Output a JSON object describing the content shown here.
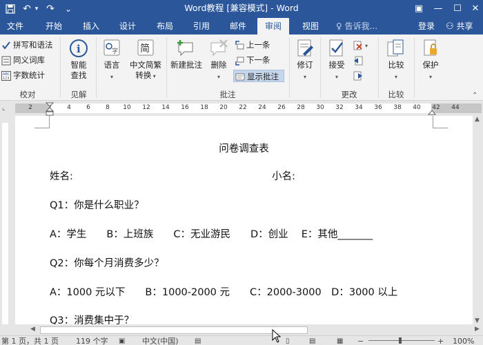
{
  "titlebar": {
    "title": "Word教程 [兼容模式] - Word",
    "undo": "↶",
    "redo": "↷",
    "customize": "⌄",
    "ribbon_options": "▣",
    "minimize": "—",
    "maximize": "☐",
    "close": "✕"
  },
  "tabs": [
    {
      "label": "文件"
    },
    {
      "label": "开始"
    },
    {
      "label": "插入"
    },
    {
      "label": "设计"
    },
    {
      "label": "布局"
    },
    {
      "label": "引用"
    },
    {
      "label": "邮件"
    },
    {
      "label": "审阅"
    },
    {
      "label": "视图"
    }
  ],
  "tellme": "♀ 告诉我...",
  "login": "登录",
  "share": "共享",
  "ribbon": {
    "proofing": {
      "items": [
        "拼写和语法",
        "同义词库",
        "字数统计"
      ],
      "label": "校对"
    },
    "insights": {
      "smart_lookup_line1": "智能",
      "smart_lookup_line2": "查找",
      "label": "见解"
    },
    "language": {
      "language": "语言",
      "convert_line1": "中文简繁",
      "convert_line2": "转换"
    },
    "comments": {
      "new_line1": "新建批注",
      "delete": "删除",
      "previous": "上一条",
      "next": "下一条",
      "show": "显示批注",
      "label": "批注"
    },
    "tracking": {
      "track": "修订"
    },
    "changes": {
      "accept": "接受",
      "label": "更改"
    },
    "compare": {
      "compare": "比较",
      "label": "比较"
    },
    "protect": {
      "protect": "保护"
    }
  },
  "ruler_ticks": [
    "2",
    "2",
    "4",
    "6",
    "8",
    "10",
    "12",
    "14",
    "16",
    "18",
    "20",
    "22",
    "24",
    "26",
    "28",
    "30",
    "32",
    "34",
    "36",
    "38",
    "40",
    "42",
    "44"
  ],
  "document": {
    "title": "问卷调查表",
    "name_label": "姓名:",
    "nickname_label": "小名:",
    "q1": "Q1：你是什么职业？",
    "q1_options": "A：学生　　B：上班族　　C：无业游民　　D：创业　 E：其他_______",
    "q2": "Q2：你每个月消费多少？",
    "q2_options": "A：1000 元以下　　B：1000-2000 元　　C：2000-3000　D：3000 以上",
    "q3": "Q3：消费集中于？"
  },
  "status": {
    "page": "第 1 页，共 1 页",
    "words": "119 个字",
    "language": "中文(中国)",
    "zoom": "100%"
  }
}
